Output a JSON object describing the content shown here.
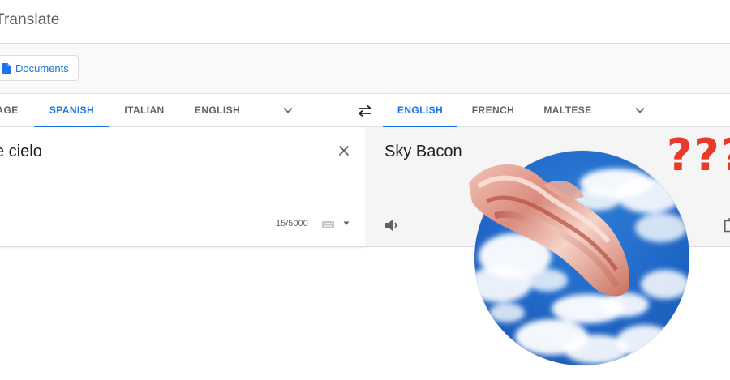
{
  "app": {
    "title": "Translate"
  },
  "mode_bar": {
    "documents_label": "Documents"
  },
  "source_langs": [
    {
      "label": "AGE",
      "active": false
    },
    {
      "label": "SPANISH",
      "active": true
    },
    {
      "label": "ITALIAN",
      "active": false
    },
    {
      "label": "ENGLISH",
      "active": false
    }
  ],
  "target_langs": [
    {
      "label": "ENGLISH",
      "active": true
    },
    {
      "label": "FRENCH",
      "active": false
    },
    {
      "label": "MALTESE",
      "active": false
    }
  ],
  "source": {
    "text": "e cielo",
    "char_count": "15/5000"
  },
  "target": {
    "text": "Sky Bacon"
  },
  "overlay": {
    "question_marks": "???"
  },
  "colors": {
    "accent": "#1a73e8",
    "qmarks": "#e8392b",
    "sky": "#1f66c6"
  },
  "icons": [
    "document-icon",
    "chevron-down-icon",
    "swap-icon",
    "close-icon",
    "keyboard-icon",
    "speaker-icon",
    "copy-icon"
  ]
}
